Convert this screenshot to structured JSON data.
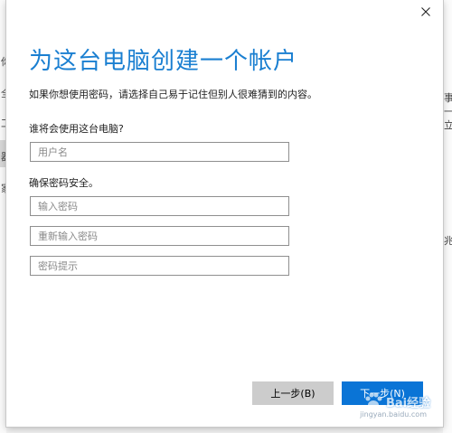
{
  "background": {
    "fragments": [
      "你",
      "全",
      "工",
      "器",
      "家",
      "事",
      "一",
      "立",
      "兆"
    ]
  },
  "dialog": {
    "title": "为这台电脑创建一个帐户",
    "description": "如果你想使用密码，请选择自己易于记住但别人很难猜到的内容。",
    "who_label": "谁将会使用这台电脑?",
    "username_placeholder": "用户名",
    "security_label": "确保密码安全。",
    "password_placeholder": "输入密码",
    "reenter_placeholder": "重新输入密码",
    "hint_placeholder": "密码提示",
    "back_button": "上一步(B)",
    "next_button": "下一步(N)",
    "close_icon": "close-icon",
    "accent_color": "#1a7fd1",
    "button_color": "#0a74d6"
  },
  "watermark": {
    "text": "Bai经验",
    "url": "jingyan.baidu.com"
  }
}
